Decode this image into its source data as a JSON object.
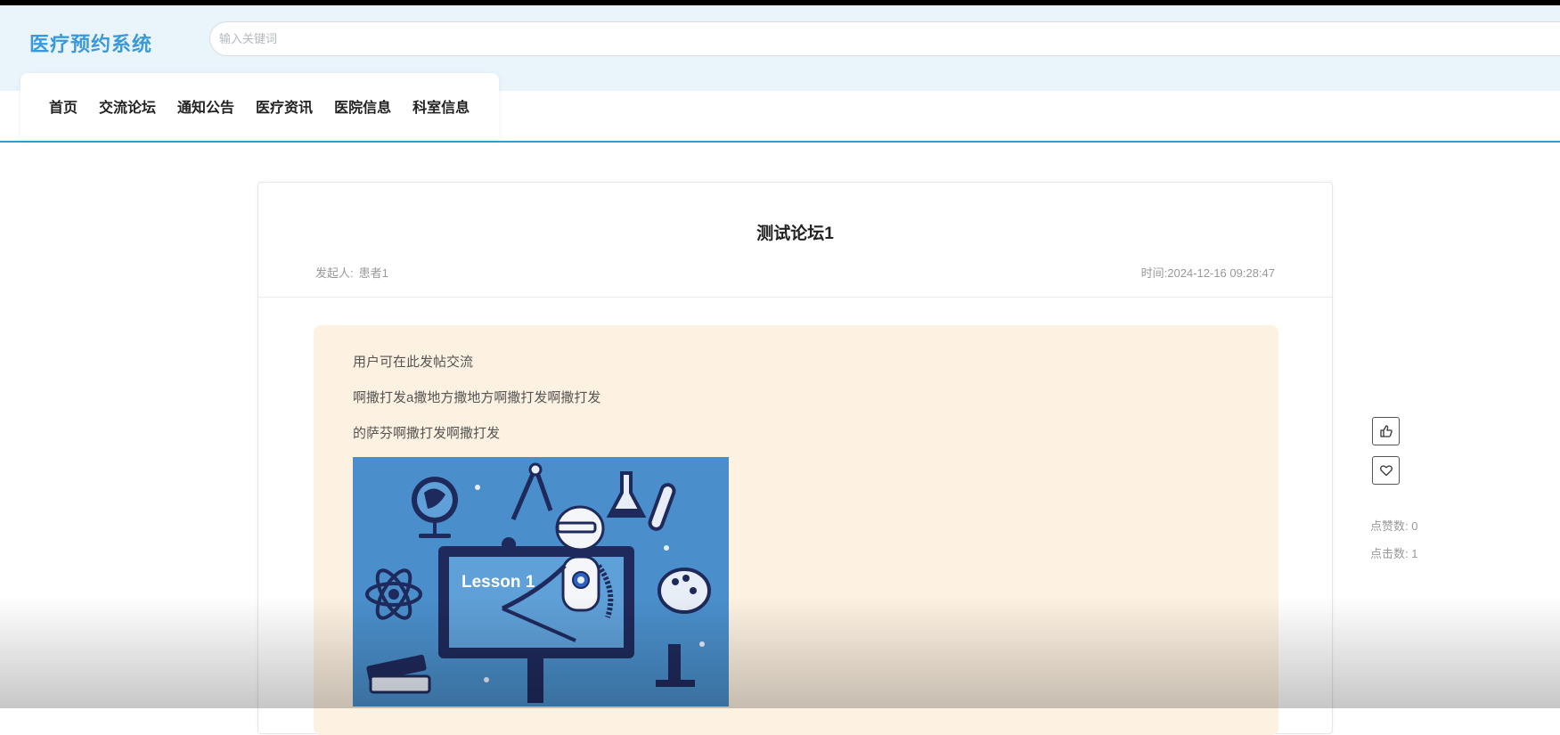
{
  "app": {
    "logo": "医疗预约系统"
  },
  "search": {
    "placeholder": "输入关键词"
  },
  "nav": {
    "items": [
      {
        "label": "首页"
      },
      {
        "label": "交流论坛"
      },
      {
        "label": "通知公告"
      },
      {
        "label": "医疗资讯"
      },
      {
        "label": "医院信息"
      },
      {
        "label": "科室信息"
      }
    ]
  },
  "post": {
    "title": "测试论坛1",
    "author_label": "发起人:",
    "author": "患者1",
    "time_label": "时间:",
    "time": "2024-12-16 09:28:47",
    "paragraphs": [
      "用户可在此发帖交流",
      "啊撒打发a撒地方撒地方啊撒打发啊撒打发",
      "的萨芬啊撒打发啊撒打发"
    ],
    "image_caption": "Lesson 1"
  },
  "side": {
    "like_icon": "thumbs-up-icon",
    "favorite_icon": "heart-icon",
    "likes_label": "点赞数:",
    "likes": "0",
    "clicks_label": "点击数:",
    "clicks": "1"
  },
  "colors": {
    "brand": "#3a9ad9",
    "header_bg": "#eaf4fb",
    "content_bg": "#fdf1e1"
  }
}
